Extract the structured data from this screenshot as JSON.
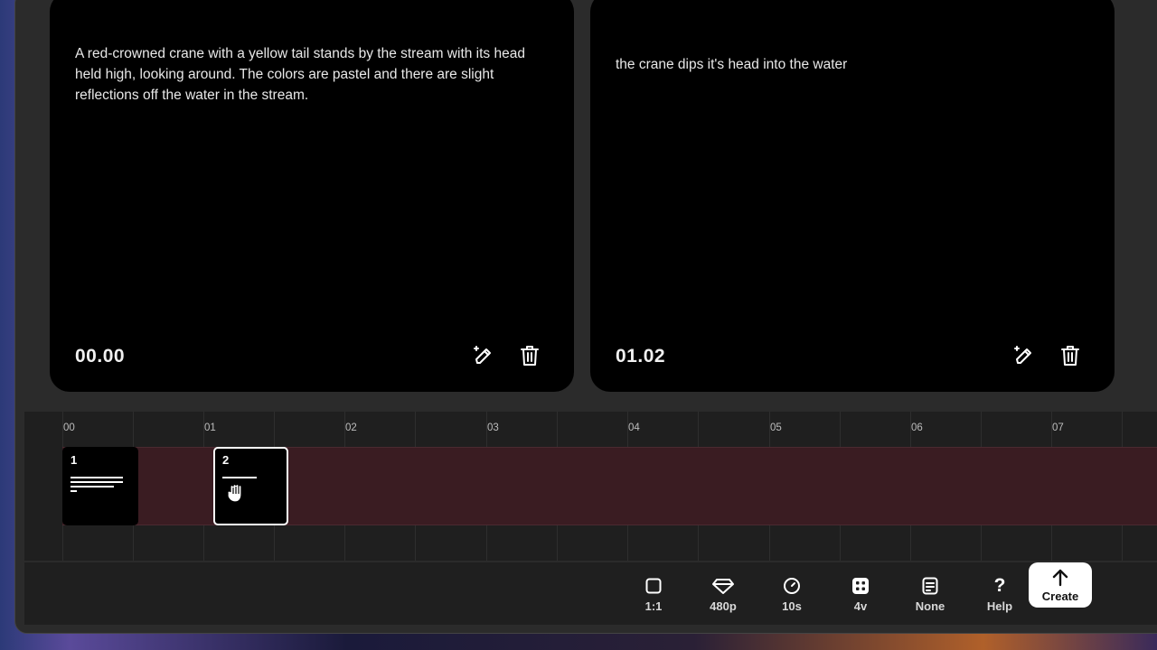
{
  "cards": [
    {
      "text": "A red-crowned crane with a yellow tail stands by the stream with its head held high, looking around. The colors are pastel and there are slight reflections off the water in the stream.",
      "time": "00.00",
      "icons": [
        "magic-pen-icon",
        "trash-icon"
      ]
    },
    {
      "text": "the crane dips it's head into the water",
      "time": "01.02",
      "icons": [
        "magic-pen-icon",
        "trash-icon"
      ]
    }
  ],
  "timeline": {
    "ticks": [
      "00",
      "01",
      "02",
      "03",
      "04",
      "05",
      "06",
      "07"
    ],
    "clips": [
      {
        "number": "1",
        "selected": false
      },
      {
        "number": "2",
        "selected": true
      }
    ],
    "track_color": "#3a1c22"
  },
  "toolbar": {
    "aspect_label": "1:1",
    "quality_label": "480p",
    "duration_label": "10s",
    "variations_label": "4v",
    "style_label": "None",
    "help_label": "Help",
    "help_glyph": "?",
    "create_label": "Create"
  }
}
